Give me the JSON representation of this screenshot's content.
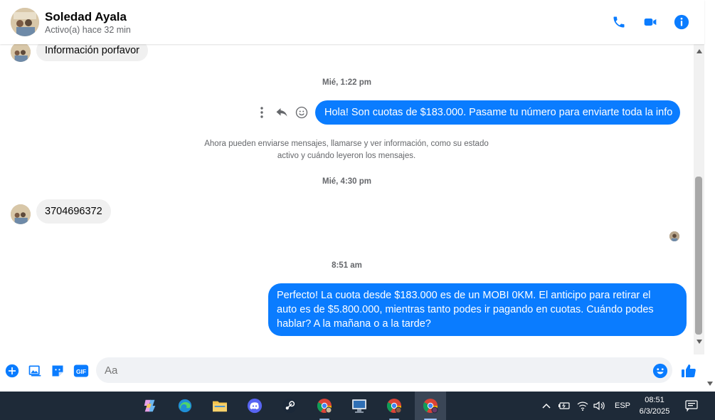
{
  "header": {
    "name": "Soledad Ayala",
    "status": "Activo(a) hace 32 min"
  },
  "messages": {
    "incoming_1": "Información porfavor",
    "ts_1": "Mié, 1:22 pm",
    "outgoing_1": "Hola! Son cuotas de $183.000. Pasame tu número para enviarte toda la info",
    "system_line_1": "Ahora pueden enviarse mensajes, llamarse y ver información, como su estado",
    "system_line_2": "activo y cuándo leyeron los mensajes.",
    "ts_2": "Mié, 4:30 pm",
    "incoming_2": "3704696372",
    "ts_3": "8:51 am",
    "outgoing_2_line_1": "Perfecto! La cuota desde $183.000 es de un MOBI 0KM. El anticipo para retirar el",
    "outgoing_2_line_2": "auto es de $5.800.000, mientras tanto podes ir pagando en cuotas. Cuándo podes",
    "outgoing_2_line_3": "hablar? A la mañana o a la tarde?"
  },
  "composer": {
    "placeholder": "Aa",
    "gif_label": "GIF"
  },
  "taskbar": {
    "language": "ESP",
    "time": "08:51",
    "date": "6/3/2025"
  },
  "colors": {
    "accent": "#0a7cff",
    "incoming_bg": "#f0f0f0",
    "taskbar_bg": "#1e2a38"
  }
}
